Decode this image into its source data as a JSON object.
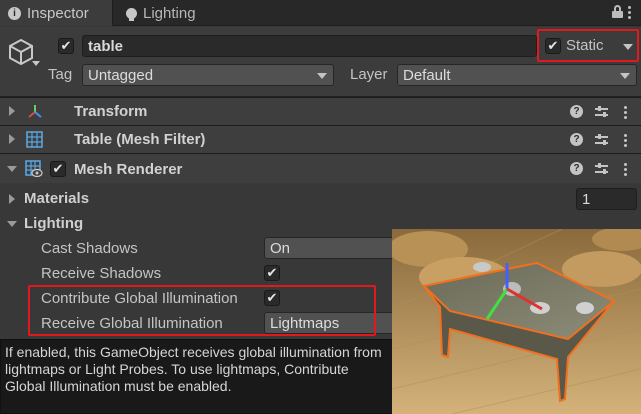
{
  "tabs": [
    {
      "label": "Inspector",
      "icon": "info-icon"
    },
    {
      "label": "Lighting",
      "icon": "lightbulb-icon"
    }
  ],
  "header": {
    "name_value": "table",
    "active_checked": true,
    "static_label": "Static",
    "static_checked": true,
    "tag_label": "Tag",
    "tag_value": "Untagged",
    "layer_label": "Layer",
    "layer_value": "Default"
  },
  "components": [
    {
      "title": "Transform",
      "icon": "transform-axes-icon",
      "expanded": false
    },
    {
      "title": "Table (Mesh Filter)",
      "icon": "mesh-filter-grid-icon",
      "expanded": false
    },
    {
      "title": "Mesh Renderer",
      "icon": "mesh-renderer-icon",
      "expanded": true,
      "enabled": true
    }
  ],
  "mesh_renderer": {
    "materials_label": "Materials",
    "materials_count": "1",
    "lighting_label": "Lighting",
    "cast_shadows_label": "Cast Shadows",
    "cast_shadows_value": "On",
    "receive_shadows_label": "Receive Shadows",
    "receive_shadows_checked": true,
    "contribute_gi_label": "Contribute Global Illumination",
    "contribute_gi_checked": true,
    "receive_gi_label": "Receive Global Illumination",
    "receive_gi_value": "Lightmaps"
  },
  "tooltip": {
    "text": "If enabled, this GameObject receives global illumination from lightmaps or Light Probes. To use lightmaps, Contribute Global Illumination must be enabled."
  },
  "colors": {
    "highlight": "#e0181f",
    "panel": "#383838",
    "header": "#3e3e3e"
  }
}
